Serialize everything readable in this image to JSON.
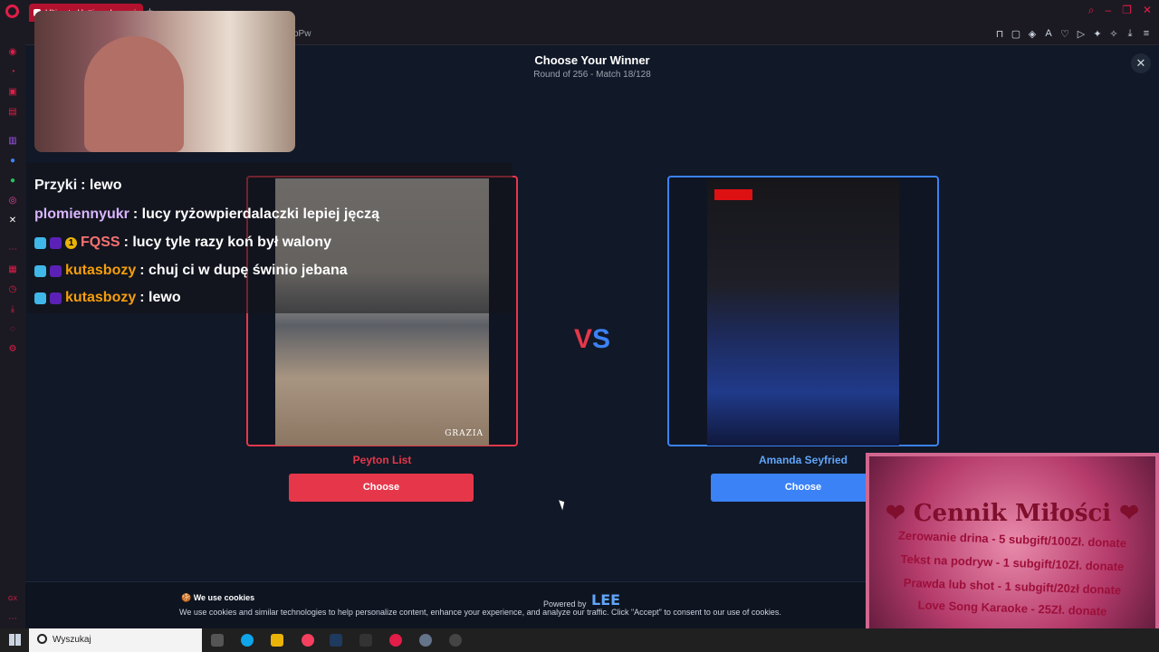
{
  "browser": {
    "tab_title": "Ultimate Hotties - Legwui",
    "url_fragment": "pPw",
    "new_tab_label": "+"
  },
  "page": {
    "title": "Choose Your Winner",
    "subtitle": "Round of 256 - Match 18/128",
    "close_label": "✕",
    "vs_v": "V",
    "vs_s": "S",
    "left": {
      "name": "Peyton List",
      "choose_label": "Choose",
      "photo_mark": "GRAZIA",
      "accent": "#e6374a"
    },
    "right": {
      "name": "Amanda Seyfried",
      "choose_label": "Choose",
      "accent": "#3b82f6"
    }
  },
  "cookie": {
    "title": "We use cookies",
    "text": "We use cookies and similar technologies to help personalize content, enhance your experience, and analyze our traffic. Click \"Accept\" to consent to our use of cookies.",
    "powered_by": "Powered by",
    "logo_text": "LEE"
  },
  "chat": {
    "messages": [
      {
        "user": "Przyki",
        "text": ": lewo"
      },
      {
        "user": "plomiennyukr",
        "text": ": lucy ryżowpierdalaczki lepiej jęczą"
      },
      {
        "user": "FQSS",
        "text": ": lucy tyle razy koń był walony",
        "badge_num": "1"
      },
      {
        "user": "kutasbozy",
        "text": ": chuj ci w dupę świnio jebana"
      },
      {
        "user": "kutasbozy",
        "text": ": lewo"
      }
    ]
  },
  "pricelist": {
    "title": "Cennik Miłości",
    "items": [
      "Zerowanie drina - 5 subgift/100Zł. donate",
      "Tekst na podryw - 1 subgift/10Zł. donate",
      "Prawda lub shot - 1 subgift/20zł donate",
      "Love Song Karaoke - 25Zł. donate"
    ]
  },
  "taskbar": {
    "search_placeholder": "Wyszukaj"
  }
}
